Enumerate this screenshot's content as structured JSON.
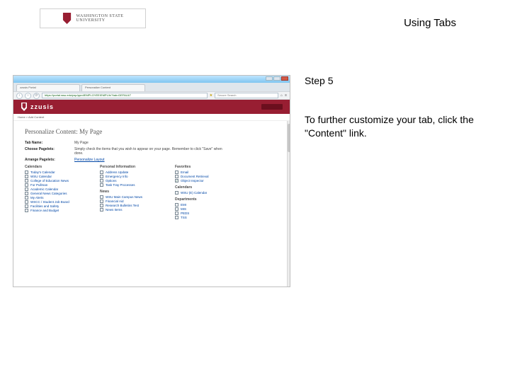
{
  "header": {
    "logo_top": "WASHINGTON STATE",
    "logo_bottom": "UNIVERSITY",
    "page_title": "Using Tabs"
  },
  "instructions": {
    "step_title": "Step 5",
    "step_body": "To further customize your tab, click the \"Content\" link."
  },
  "screenshot": {
    "browser": {
      "tab1": "zzusis Portal",
      "tab2": "Personalize Content",
      "url": "https://portal.wsu.edu/psp/pprd/EMPLOYEE/EMPL/h/?tab=DEFAULT",
      "search": "Secure Search"
    },
    "zzusis_brand": "zzusis",
    "crumb": "Home  >  Add Content",
    "page_h1": "Personalize Content: My Page",
    "rows": {
      "tabname_label": "Tab Name:",
      "tabname_value": "My Page",
      "choose_label": "Choose Pagelets:",
      "choose_value": "Simply check the items that you wish to appear on your page. Remember to click \"Save\" when done.",
      "arrange_label": "Arrange Pagelets:",
      "arrange_link": "Personalize Layout"
    },
    "columns": {
      "calendars": {
        "title": "Calendars",
        "items": [
          "Today's Calendar",
          "WSU Calendar",
          "College of Education News",
          "For Pullman",
          "Academic Calendar",
          "General News Categories",
          "My Alerts",
          "WSCC / Student Job Board",
          "Facilities and Safety",
          "Finance and Budget"
        ]
      },
      "personal": {
        "title": "Personal Information",
        "items": [
          "Address Update",
          "Emergency Info",
          "Options",
          "Task Tray Processes"
        ],
        "news_title": "News",
        "news_items": [
          "WSU Main Campus News",
          "Financial Aid",
          "Research Bulletins Test",
          "News Items"
        ]
      },
      "favorites": {
        "title": "Favorites",
        "items": [
          "Email",
          "Document Retrieval",
          "Object Inspector"
        ],
        "cal2_title": "Calendars",
        "cal2_items": [
          "WSU (E) Calendar"
        ],
        "dept_title": "Departments",
        "dept_items": [
          "EMI",
          "MIS",
          "PEDS",
          "TSS"
        ]
      }
    },
    "checked": [
      "Object Inspector"
    ]
  }
}
